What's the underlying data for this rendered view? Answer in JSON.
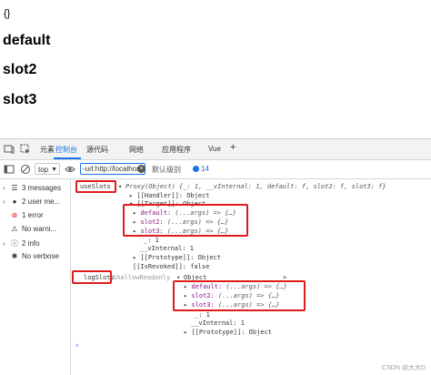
{
  "page": {
    "braces": "{}",
    "headings": [
      "default",
      "slot2",
      "slot3"
    ]
  },
  "devtools": {
    "tabs": [
      "元素",
      "控制台",
      "源代码",
      "网络",
      "应用程序",
      "Vue"
    ],
    "add_tab": "+",
    "toolbar": {
      "context": "top",
      "filter_value": "-url:http://localhos",
      "levels": "默认级别",
      "issues_count": "14"
    },
    "sidebar": [
      {
        "label": "3 messages",
        "icon": "list-icon"
      },
      {
        "label": "2 user me...",
        "icon": "user-icon"
      },
      {
        "label": "1 error",
        "icon": "error-icon"
      },
      {
        "label": "No warni...",
        "icon": "warning-icon"
      },
      {
        "label": "2 info",
        "icon": "info-icon"
      },
      {
        "label": "No verbose",
        "icon": "bug-icon"
      }
    ],
    "console": {
      "log1_label": "useSlots",
      "log1_summary": "Proxy(Object) {_: 1, __vInternal: 1, default: f, slot2: f, slot3: f}",
      "handler": "[[Handler]]: Object",
      "target": "[[Target]]: Object",
      "t_default_key": "default:",
      "t_default_val": "(...args) => {…}",
      "t_slot2_key": "slot2:",
      "t_slot2_val": "(...args) => {…}",
      "t_slot3_key": "slot3:",
      "t_slot3_val": "(...args) => {…}",
      "t_underscore": "_: 1",
      "t_vinternal": "__vInternal: 1",
      "t_prototype": "[[Prototype]]: Object",
      "is_revoked": "[[IsRevoked]]: false",
      "log2_label": "logSlots",
      "log2_summary": "ShallowReadonly",
      "log2_obj": "Object",
      "log2_expand": ">",
      "s_default_key": "default:",
      "s_default_val": "(...args) => {…}",
      "s_slot2_key": "slot2:",
      "s_slot2_val": "(...args) => {…}",
      "s_slot3_key": "slot3:",
      "s_slot3_val": "(...args) => {…}",
      "s_underscore": "_: 1",
      "s_vinternal": "__vInternal: 1",
      "s_prototype": "[[Prototype]]: Object",
      "prompt": "›"
    },
    "watermark": "CSDN @大大D"
  }
}
